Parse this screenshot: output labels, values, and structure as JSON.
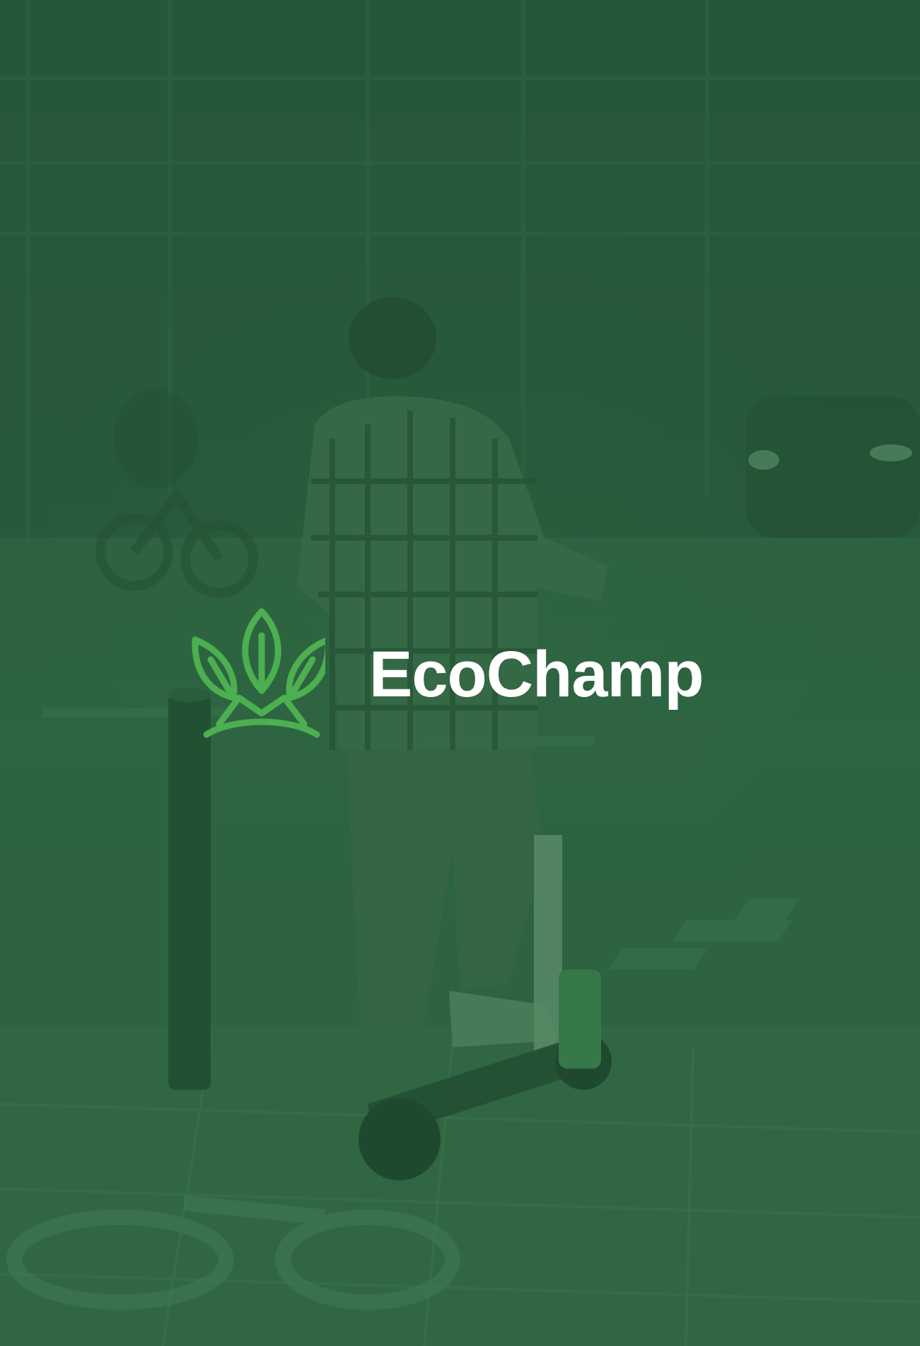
{
  "brand": {
    "name": "EcoChamp",
    "logo_icon": "leaf-crown-icon",
    "logo_color": "#4caf50",
    "text_color": "#ffffff"
  },
  "background": {
    "overlay_color": "#2b5e3a",
    "scene_icon": "street-scooter-rider-photo"
  }
}
